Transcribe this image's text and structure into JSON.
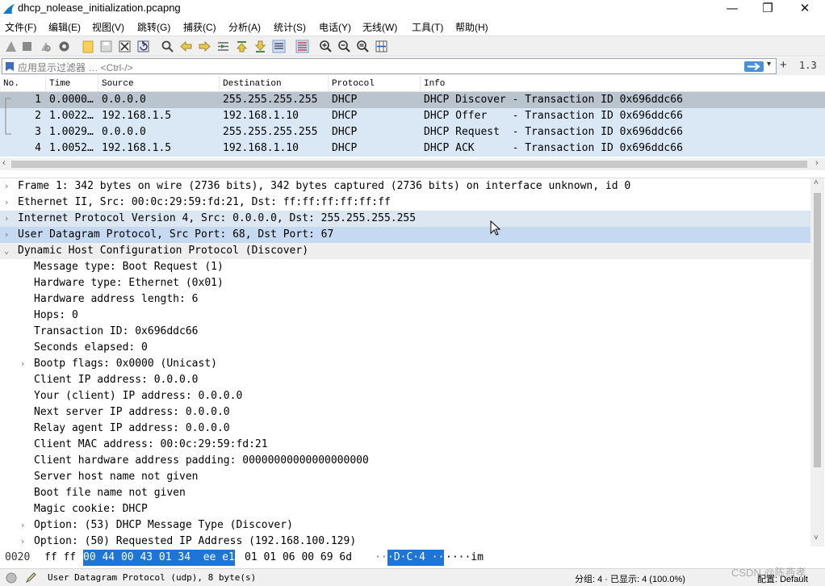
{
  "window": {
    "title": "dhcp_nolease_initialization.pcapng",
    "minimize": "—",
    "maximize": "❐",
    "close": "✕"
  },
  "menu": [
    "文件(F)",
    "编辑(E)",
    "视图(V)",
    "跳转(G)",
    "捕获(C)",
    "分析(A)",
    "统计(S)",
    "电话(Y)",
    "无线(W)",
    "工具(T)",
    "帮助(H)"
  ],
  "filter": {
    "placeholder": "应用显示过滤器 … <Ctrl-/>",
    "version": "1.3"
  },
  "packet_list": {
    "columns": [
      "No.",
      "Time",
      "Source",
      "Destination",
      "Protocol",
      "Info"
    ],
    "rows": [
      {
        "no": "1",
        "time": "0.0000…",
        "src": "0.0.0.0",
        "dst": "255.255.255.255",
        "proto": "DHCP",
        "info": "DHCP Discover - Transaction ID 0x696ddc66",
        "selected": true
      },
      {
        "no": "2",
        "time": "1.0022…",
        "src": "192.168.1.5",
        "dst": "192.168.1.10",
        "proto": "DHCP",
        "info": "DHCP Offer    - Transaction ID 0x696ddc66",
        "selected": false
      },
      {
        "no": "3",
        "time": "1.0029…",
        "src": "0.0.0.0",
        "dst": "255.255.255.255",
        "proto": "DHCP",
        "info": "DHCP Request  - Transaction ID 0x696ddc66",
        "selected": false
      },
      {
        "no": "4",
        "time": "1.0052…",
        "src": "192.168.1.5",
        "dst": "192.168.1.10",
        "proto": "DHCP",
        "info": "DHCP ACK      - Transaction ID 0x696ddc66",
        "selected": false
      }
    ]
  },
  "details": {
    "lines": [
      {
        "text": "Frame 1: 342 bytes on wire (2736 bits), 342 bytes captured (2736 bits) on interface unknown, id 0",
        "indent": 0,
        "arrow": "›",
        "style": ""
      },
      {
        "text": "Ethernet II, Src: 00:0c:29:59:fd:21, Dst: ff:ff:ff:ff:ff:ff",
        "indent": 0,
        "arrow": "›",
        "style": ""
      },
      {
        "text": "Internet Protocol Version 4, Src: 0.0.0.0, Dst: 255.255.255.255",
        "indent": 0,
        "arrow": "›",
        "style": "hl"
      },
      {
        "text": "User Datagram Protocol, Src Port: 68, Dst Port: 67",
        "indent": 0,
        "arrow": "›",
        "style": "sel"
      },
      {
        "text": "Dynamic Host Configuration Protocol (Discover)",
        "indent": 0,
        "arrow": "⌄",
        "style": "alt"
      },
      {
        "text": "Message type: Boot Request (1)",
        "indent": 1,
        "arrow": "",
        "style": ""
      },
      {
        "text": "Hardware type: Ethernet (0x01)",
        "indent": 1,
        "arrow": "",
        "style": ""
      },
      {
        "text": "Hardware address length: 6",
        "indent": 1,
        "arrow": "",
        "style": ""
      },
      {
        "text": "Hops: 0",
        "indent": 1,
        "arrow": "",
        "style": ""
      },
      {
        "text": "Transaction ID: 0x696ddc66",
        "indent": 1,
        "arrow": "",
        "style": ""
      },
      {
        "text": "Seconds elapsed: 0",
        "indent": 1,
        "arrow": "",
        "style": ""
      },
      {
        "text": "Bootp flags: 0x0000 (Unicast)",
        "indent": 1,
        "arrow": "›",
        "style": ""
      },
      {
        "text": "Client IP address: 0.0.0.0",
        "indent": 1,
        "arrow": "",
        "style": ""
      },
      {
        "text": "Your (client) IP address: 0.0.0.0",
        "indent": 1,
        "arrow": "",
        "style": ""
      },
      {
        "text": "Next server IP address: 0.0.0.0",
        "indent": 1,
        "arrow": "",
        "style": ""
      },
      {
        "text": "Relay agent IP address: 0.0.0.0",
        "indent": 1,
        "arrow": "",
        "style": ""
      },
      {
        "text": "Client MAC address: 00:0c:29:59:fd:21",
        "indent": 1,
        "arrow": "",
        "style": ""
      },
      {
        "text": "Client hardware address padding: 00000000000000000000",
        "indent": 1,
        "arrow": "",
        "style": ""
      },
      {
        "text": "Server host name not given",
        "indent": 1,
        "arrow": "",
        "style": ""
      },
      {
        "text": "Boot file name not given",
        "indent": 1,
        "arrow": "",
        "style": ""
      },
      {
        "text": "Magic cookie: DHCP",
        "indent": 1,
        "arrow": "",
        "style": ""
      },
      {
        "text": "Option: (53) DHCP Message Type (Discover)",
        "indent": 1,
        "arrow": "›",
        "style": ""
      },
      {
        "text": "Option: (50) Requested IP Address (192.168.100.129)",
        "indent": 1,
        "arrow": "›",
        "style": ""
      }
    ]
  },
  "hex": {
    "offset": "0020",
    "pre": "ff ff",
    "sel": "00 44 00 43 01 34  ee e1",
    "post": "01 01 06 00 69 6d",
    "ascii_pre": "··",
    "ascii_sel": "·D·C·4 ··",
    "ascii_post": "····im"
  },
  "status": {
    "field": "User Datagram Protocol (udp), 8 byte(s)",
    "packets": "分组: 4 · 已显示: 4 (100.0%)",
    "profile": "配置: Default",
    "watermark": "CSDN @陈燕孝"
  },
  "colors": {
    "row_bg": "#dae8f5",
    "row_selected": "#b9c4cf",
    "hex_selected": "#1e75d6"
  }
}
